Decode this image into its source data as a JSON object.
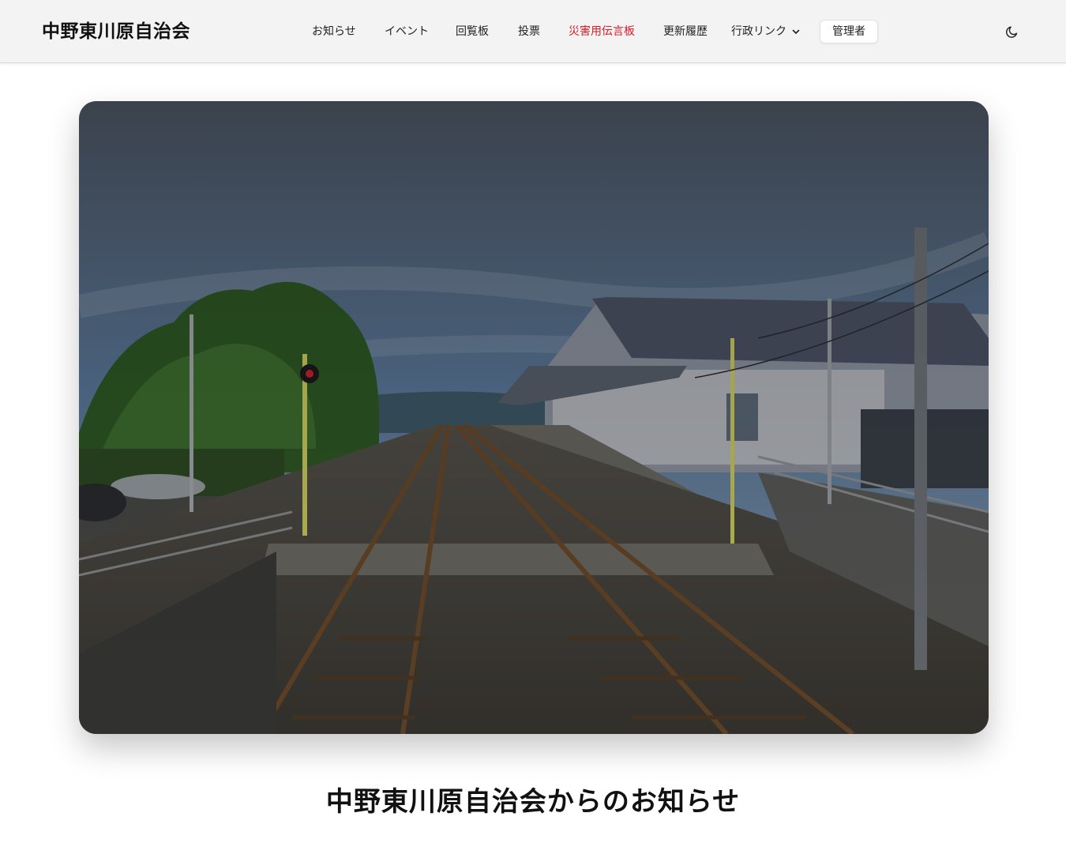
{
  "site": {
    "title": "中野東川原自治会"
  },
  "nav": {
    "items": [
      {
        "label": "お知らせ"
      },
      {
        "label": "イベント"
      },
      {
        "label": "回覧板"
      },
      {
        "label": "投票"
      },
      {
        "label": "災害用伝言板"
      },
      {
        "label": "更新履歴"
      }
    ],
    "dropdown_label": "行政リンク",
    "admin_label": "管理者"
  },
  "icons": {
    "dropdown": "chevron-down-icon",
    "theme": "moon-icon"
  },
  "colors": {
    "accent_danger": "#d81b27",
    "navbar_bg": "#f3f3f3"
  },
  "main": {
    "section_title": "中野東川原自治会からのお知らせ"
  }
}
